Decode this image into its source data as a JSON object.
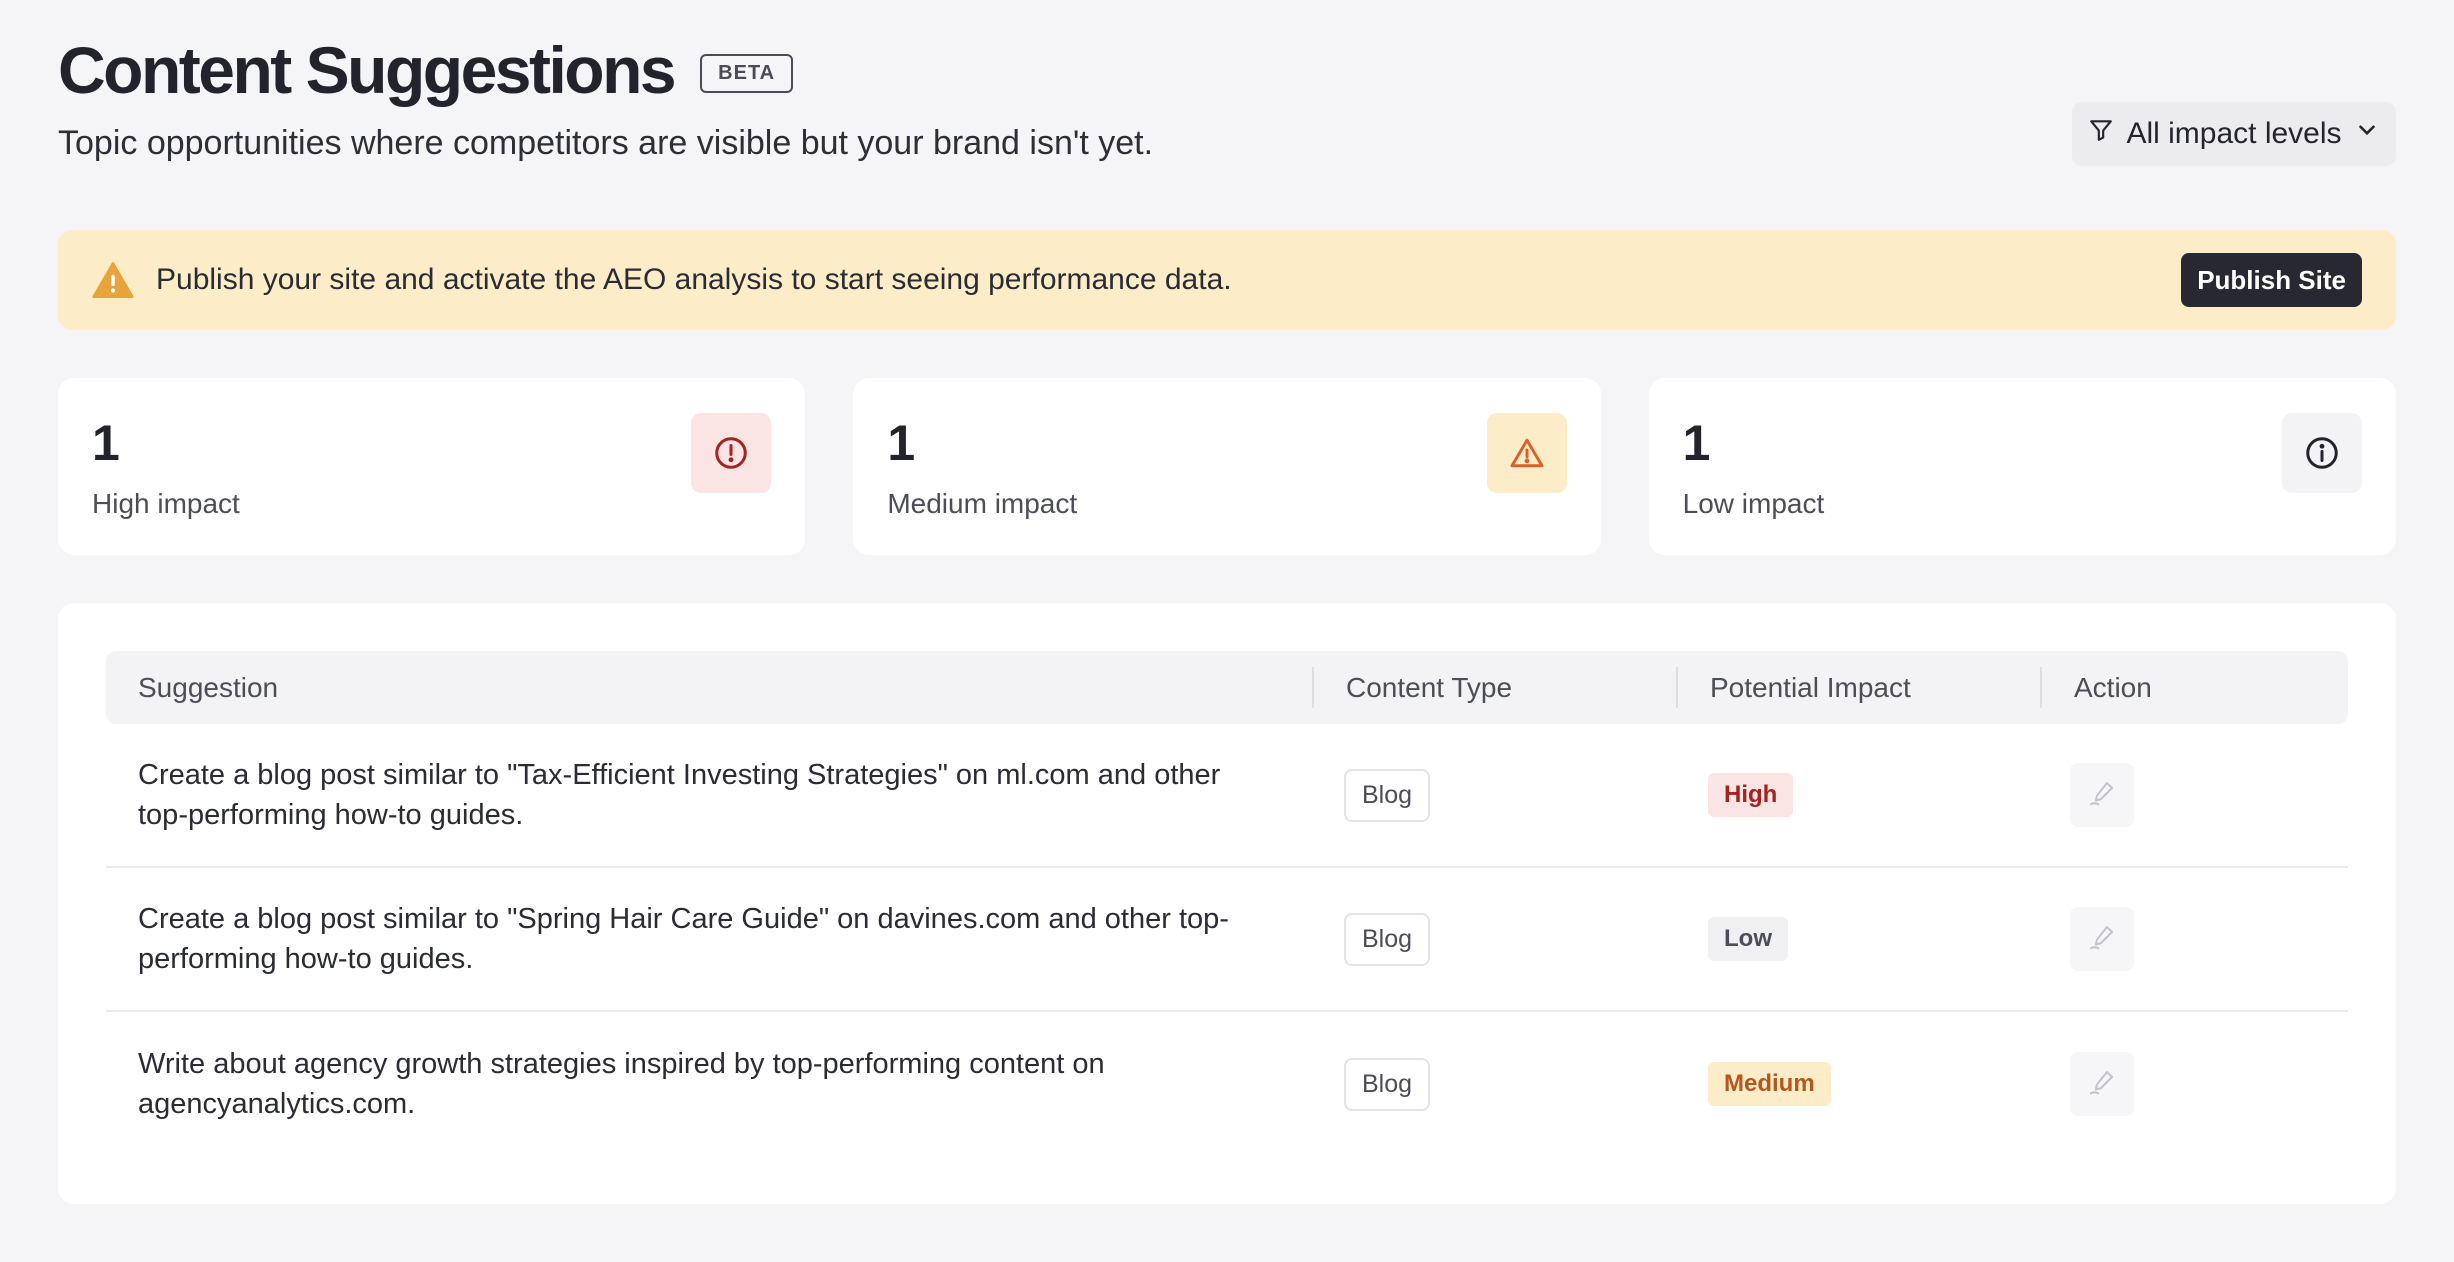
{
  "header": {
    "title": "Content Suggestions",
    "badge": "BETA",
    "subtitle": "Topic opportunities where competitors are visible but your brand isn't yet.",
    "filter_label": "All impact levels",
    "filter_icon": "funnel-icon"
  },
  "alert": {
    "icon": "warning-triangle-icon",
    "message": "Publish your site and activate the AEO analysis to start seeing performance data.",
    "button_label": "Publish Site"
  },
  "stats": [
    {
      "value": "1",
      "label": "High impact",
      "icon": "alert-circle-icon",
      "color": "#a32222",
      "bg": "#fbe4e4"
    },
    {
      "value": "1",
      "label": "Medium impact",
      "icon": "warning-triangle-icon",
      "color": "#d9612b",
      "bg": "#fcedc8"
    },
    {
      "value": "1",
      "label": "Low impact",
      "icon": "info-circle-icon",
      "color": "#22232b",
      "bg": "#f3f3f5"
    }
  ],
  "table": {
    "columns": [
      "Suggestion",
      "Content Type",
      "Potential Impact",
      "Action"
    ],
    "rows": [
      {
        "suggestion": "Create a blog post similar to \"Tax-Efficient Investing Strategies\" on ml.com and other top-performing how-to guides.",
        "type": "Blog",
        "impact": "High",
        "action_icon": "pen-icon"
      },
      {
        "suggestion": "Create a blog post similar to \"Spring Hair Care Guide\" on davines.com and other top-performing how-to guides.",
        "type": "Blog",
        "impact": "Low",
        "action_icon": "pen-icon"
      },
      {
        "suggestion": "Write about agency growth strategies inspired by top-performing content on agencyanalytics.com.",
        "type": "Blog",
        "impact": "Medium",
        "action_icon": "pen-icon"
      }
    ]
  },
  "impact_colors": {
    "High": {
      "fg": "#a32222",
      "bg": "#fbe4e4"
    },
    "Medium": {
      "fg": "#b5561f",
      "bg": "#fcedc8"
    },
    "Low": {
      "fg": "#4c4d57",
      "bg": "#f0f0f3"
    }
  }
}
